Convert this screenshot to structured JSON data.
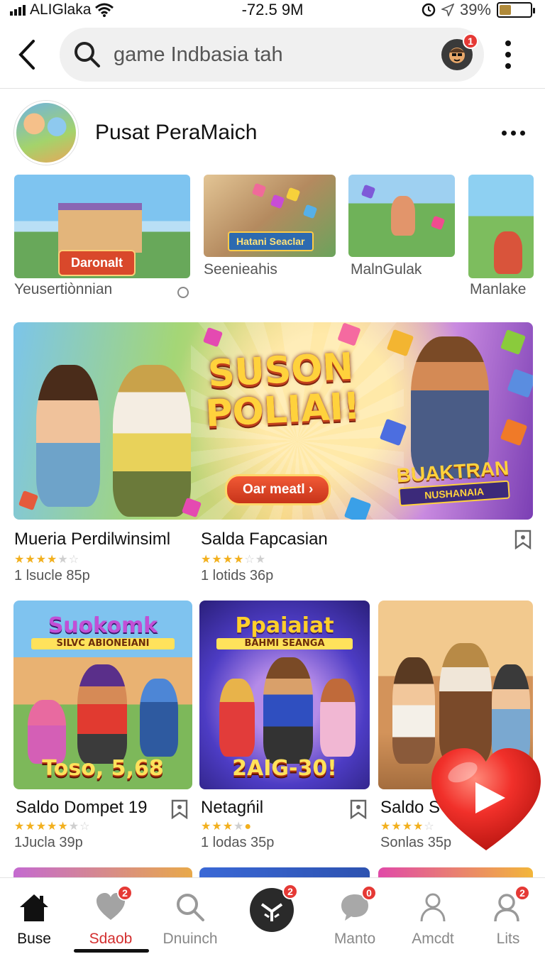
{
  "status_bar": {
    "carrier": "ALIGlaka",
    "time": "-72.5 9M",
    "battery": "39%",
    "battery_level": 0.39
  },
  "header": {
    "search_query": "game Indbasia tah",
    "avatar_badge": "1"
  },
  "channel": {
    "name": "Pusat PeraMaich"
  },
  "thumbs": [
    {
      "pill": "Daronalt",
      "caption": "Yeusertiònnian"
    },
    {
      "pill": "Hatani Seaclar",
      "caption": "Seenieahis"
    },
    {
      "caption": "MalnGulak"
    },
    {
      "caption": "Manlake"
    }
  ],
  "banner": {
    "title": "SUSON POLIAI!",
    "cta": "Oar meatl",
    "sub_title": "BUAKTRAN",
    "sub_tag": "NUSHANAIA"
  },
  "featured": [
    {
      "title": "Mueria Perdilwinsiml",
      "meta": "1 lsucle 85p",
      "rating": 3.5
    },
    {
      "title": "Salda Fapcasian",
      "meta": "1 lotids 36p",
      "rating": 3.5
    }
  ],
  "grid": [
    {
      "top": "Suokomk",
      "top_tag": "SILVC ABIONEIANI",
      "bottom": "Toso, 5,68",
      "title": "Saldo Dompet 19",
      "meta": "1Jucla 39p",
      "rating": 4.5
    },
    {
      "top": "Ppaiaiat",
      "top_tag": "BAHMI SEANGA",
      "bottom": "2AIG-30!",
      "title": "Netagńil",
      "meta": "1 lodas 35p",
      "rating": 4
    },
    {
      "title": "Saldo S",
      "meta": "Sonlas 35p",
      "rating": 4
    }
  ],
  "nav": [
    {
      "label": "Buse",
      "badge": ""
    },
    {
      "label": "Sdaob",
      "badge": "2"
    },
    {
      "label": "Dnuinch",
      "badge": ""
    },
    {
      "label": "",
      "badge": "2"
    },
    {
      "label": "Manto",
      "badge": "0"
    },
    {
      "label": "Amcdt",
      "badge": ""
    },
    {
      "label": "Lits",
      "badge": "2"
    }
  ],
  "colors": {
    "accent": "#d32f2f",
    "star": "#f2b01e",
    "badge": "#e53935"
  }
}
